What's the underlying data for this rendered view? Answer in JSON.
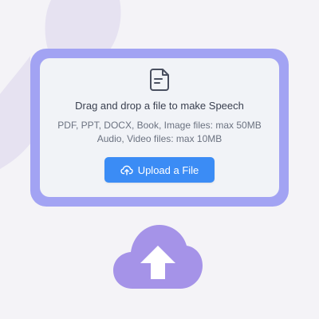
{
  "dropzone": {
    "headline": "Drag and drop a file to make Speech",
    "limit_documents": "PDF, PPT, DOCX, Book, Image files: max 50MB",
    "limit_media": "Audio, Video files: max 10MB",
    "icon": "document-icon"
  },
  "upload_button": {
    "label": "Upload a File",
    "icon": "cloud-upload-icon"
  },
  "decor": {
    "cloud_icon": "cloud-upload-illustration"
  },
  "colors": {
    "accent": "#3b8cf5",
    "frame": "#a2a3f3",
    "cloud": "#a593e8",
    "background": "#f4f3f7"
  }
}
